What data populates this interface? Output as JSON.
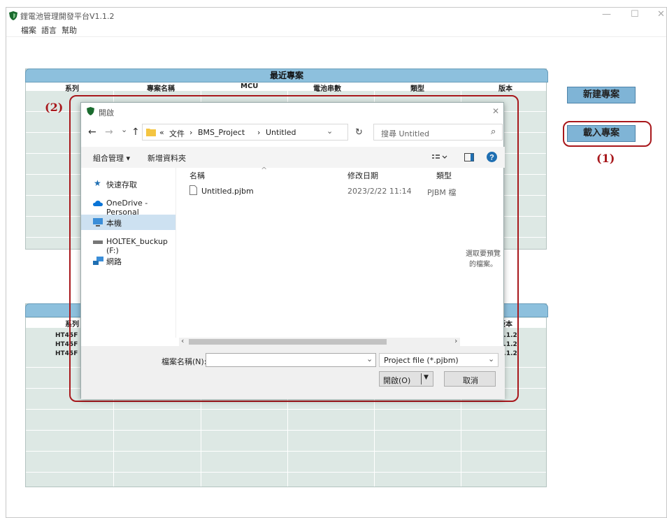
{
  "app": {
    "title": "鋰電池管理開發平台V1.1.2",
    "brand_color": "#1a6b2e"
  },
  "window_controls": {
    "minimize": "—",
    "maximize": "☐",
    "close": "✕"
  },
  "menu": [
    "檔案",
    "語言",
    "幫助"
  ],
  "recent_panel": {
    "title": "最近專案",
    "columns": [
      "系列",
      "專案名稱",
      "MCU",
      "電池串數",
      "類型",
      "版本"
    ]
  },
  "lower_panel": {
    "col_first": "系列",
    "col_last": "版本",
    "rows": [
      {
        "series": "HT45F",
        "version": "1.1.2"
      },
      {
        "series": "HT45F",
        "version": "1.1.2"
      },
      {
        "series": "HT45F",
        "version": "1.1.2"
      }
    ],
    "row_series_visible": [
      "HT45F",
      "HT45F",
      "HT45F"
    ],
    "row_version_visible": [
      "..1.2",
      "..1.2",
      "..1.2"
    ]
  },
  "buttons": {
    "new_project": "新建專案",
    "load_project": "載入專案"
  },
  "annotations": {
    "label_1": "(1)",
    "label_2": "(2)",
    "color": "#a8181c"
  },
  "dialog": {
    "title": "開啟",
    "close": "✕",
    "nav": {
      "back": "←",
      "forward": "→",
      "recent": "⌄",
      "up": "↑",
      "refresh": "↻"
    },
    "breadcrumb": {
      "overflow": "«",
      "parts": [
        "文件",
        "BMS_Project",
        "Untitled"
      ],
      "sep": "›"
    },
    "search_placeholder": "搜尋 Untitled",
    "search_icon": "⌕",
    "toolbar": {
      "organize": "組合管理 ▾",
      "new_folder": "新增資料夾"
    },
    "nav_pane": [
      {
        "label": "快速存取",
        "icon": "star-icon"
      },
      {
        "label": "OneDrive - Personal",
        "icon": "cloud-icon"
      },
      {
        "label": "本機",
        "icon": "computer-icon"
      },
      {
        "label": "HOLTEK_buckup (F:)",
        "icon": "drive-icon"
      },
      {
        "label": "網路",
        "icon": "network-icon"
      }
    ],
    "columns": {
      "name": "名稱",
      "modified": "修改日期",
      "type": "類型"
    },
    "files": [
      {
        "name": "Untitled.pjbm",
        "modified": "2023/2/22 11:14",
        "type": "PJBM 檔"
      }
    ],
    "preview_line1": "選取要預覽",
    "preview_line2": "的檔案。",
    "filename_label": "檔案名稱(N):",
    "filename_value": "",
    "filter": "Project file (*.pjbm)",
    "open_button": "開啟(O)",
    "cancel_button": "取消"
  }
}
